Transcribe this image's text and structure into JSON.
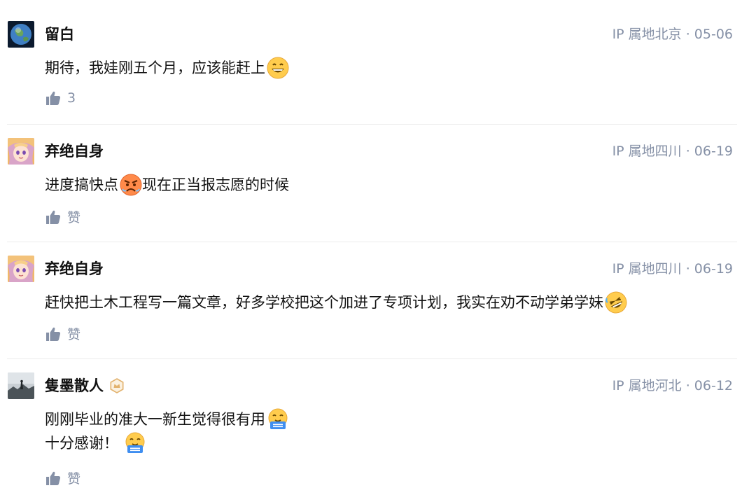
{
  "comments": [
    {
      "author": "留白",
      "meta": "IP 属地北京 · 05-06",
      "lines": [
        "期待，我娃刚五个月，应该能赶上"
      ],
      "like_label": "3"
    },
    {
      "author": "弃绝自身",
      "meta": "IP 属地四川 · 06-19",
      "lines": [
        "进度搞快点",
        "现在正当报志愿的时候"
      ],
      "like_label": "赞"
    },
    {
      "author": "弃绝自身",
      "meta": "IP 属地四川 · 06-19",
      "lines": [
        "赶快把土木工程写一篇文章，好多学校把这个加进了专项计划，我实在劝不动学弟学妹"
      ],
      "like_label": "赞"
    },
    {
      "author": "隻墨散人",
      "meta": "IP 属地河北 · 06-12",
      "lines": [
        "刚刚毕业的准大一新生觉得很有用",
        "十分感谢！"
      ],
      "like_label": "赞"
    }
  ],
  "icons": {
    "like": "thumbs-up-icon",
    "emoji_grin": "grinning-face-emoji",
    "emoji_angry": "angry-face-emoji",
    "emoji_rofl": "rolling-laughing-emoji",
    "emoji_agree": "agree-face-emoji",
    "badge": "creator-badge-icon"
  },
  "colors": {
    "meta_gray": "#8590a6",
    "text": "#121212",
    "divider": "#ececec",
    "badge_gold": "#e2b26e"
  }
}
